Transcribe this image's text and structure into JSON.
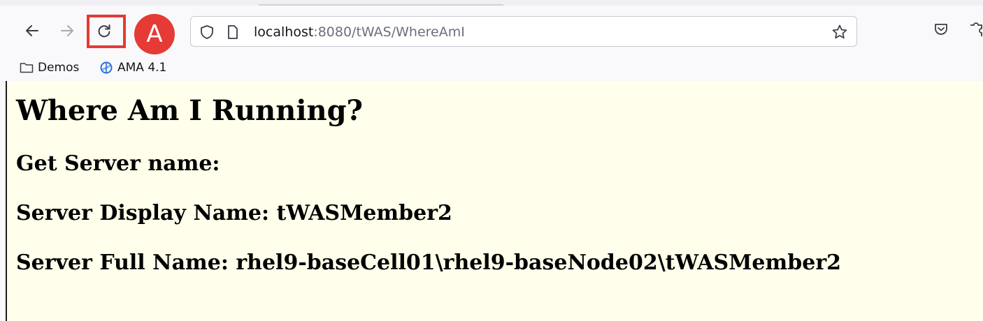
{
  "browser": {
    "url_host": "localhost",
    "url_rest": ":8080/tWAS/WhereAmI",
    "callout_label": "A",
    "icons": {
      "back": "arrow-left-icon",
      "forward": "arrow-right-icon",
      "reload": "reload-icon",
      "site_info": "shield-icon",
      "page": "page-icon",
      "bookmark_star": "star-icon",
      "pocket": "pocket-icon",
      "extensions": "puzzle-icon"
    },
    "highlight_color": "#e53a35"
  },
  "bookmarks": [
    {
      "label": "Demos",
      "icon": "folder-icon"
    },
    {
      "label": "AMA 4.1",
      "icon": "ama-logo-icon"
    }
  ],
  "page": {
    "title": "Where Am I Running?",
    "get_server_name": "Get Server name:",
    "display_name_line": "Server Display Name: tWASMember2",
    "full_name_line": "Server Full Name: rhel9-baseCell01\\rhel9-baseNode02\\tWASMember2",
    "background_color": "#ffffeb"
  }
}
